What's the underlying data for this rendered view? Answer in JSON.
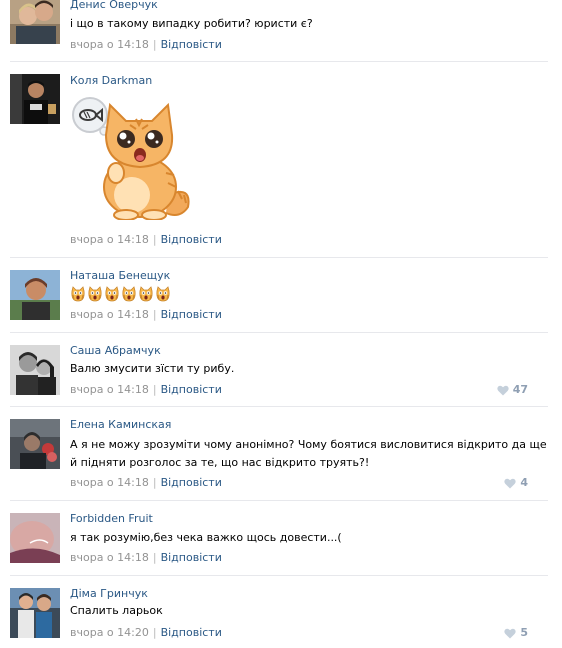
{
  "comments": [
    {
      "author": "Денис Оверчук",
      "text": "і що в такому випадку робити? юристи є?",
      "time": "вчора о 14:18",
      "sep": "|",
      "reply": "Відповісти",
      "likes": ""
    },
    {
      "author": "Коля Darkman",
      "sticker": "cat-sticker-icon",
      "time": "вчора о 14:18",
      "sep": "|",
      "reply": "Відповісти",
      "likes": ""
    },
    {
      "author": "Наташа Бенещук",
      "emoji": [
        "scream-emoji-icon",
        "scream-emoji-icon",
        "scream-emoji-icon",
        "scream-emoji-icon",
        "scream-emoji-icon",
        "scream-emoji-icon"
      ],
      "time": "вчора о 14:18",
      "sep": "|",
      "reply": "Відповісти",
      "likes": ""
    },
    {
      "author": "Саша Абрамчук",
      "text": "Валю змусити зїсти ту рибу.",
      "time": "вчора о 14:18",
      "sep": "|",
      "reply": "Відповісти",
      "likes": "47"
    },
    {
      "author": "Елена Каминская",
      "text": "А я не можу зрозуміти чому анонімно? Чому боятися висловитися відкрито да ще й підняти розголос за те, що нас відкрито труять?!",
      "time": "вчора о 14:18",
      "sep": "|",
      "reply": "Відповісти",
      "likes": "4"
    },
    {
      "author": "Forbidden Fruit",
      "text": "я так розумію,без чека важко щось довести...(",
      "time": "вчора о 14:18",
      "sep": "|",
      "reply": "Відповісти",
      "likes": ""
    },
    {
      "author": "Діма Гринчук",
      "text": "Спалить ларьок",
      "time": "вчора о 14:20",
      "sep": "|",
      "reply": "Відповісти",
      "likes": "5"
    }
  ],
  "colors": {
    "link": "#2a5885",
    "meta": "#939393",
    "like": "#8f9fb3",
    "divider": "#e7e8ec"
  }
}
